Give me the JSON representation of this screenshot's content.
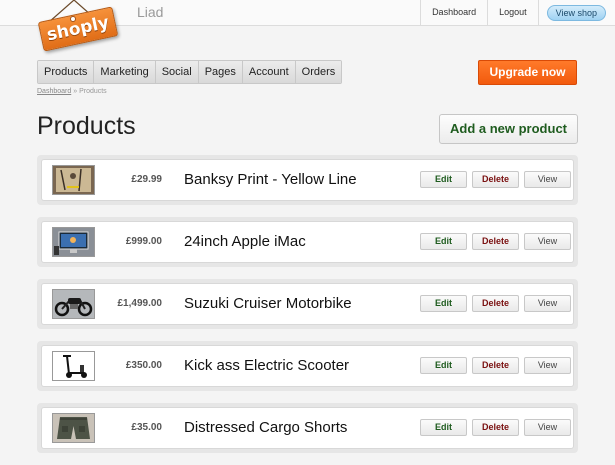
{
  "header": {
    "logo_text": "shoply",
    "username": "Liad",
    "links": [
      {
        "label": "Dashboard"
      },
      {
        "label": "Logout"
      }
    ],
    "view_shop_label": "View shop"
  },
  "nav": {
    "tabs": [
      {
        "label": "Products"
      },
      {
        "label": "Marketing"
      },
      {
        "label": "Social"
      },
      {
        "label": "Pages"
      },
      {
        "label": "Account"
      },
      {
        "label": "Orders"
      }
    ],
    "upgrade_label": "Upgrade now"
  },
  "breadcrumb": {
    "link": "Dashboard",
    "separator": "»",
    "current": "Products"
  },
  "page": {
    "title": "Products",
    "add_button": "Add a new product"
  },
  "products": [
    {
      "price": "£29.99",
      "name": "Banksy Print - Yellow Line",
      "thumb": "print"
    },
    {
      "price": "£999.00",
      "name": "24inch Apple iMac",
      "thumb": "imac"
    },
    {
      "price": "£1,499.00",
      "name": "Suzuki Cruiser Motorbike",
      "thumb": "motorbike"
    },
    {
      "price": "£350.00",
      "name": "Kick ass Electric Scooter",
      "thumb": "scooter"
    },
    {
      "price": "£35.00",
      "name": "Distressed Cargo Shorts",
      "thumb": "shorts"
    }
  ],
  "row_actions": {
    "edit": "Edit",
    "delete": "Delete",
    "view": "View"
  },
  "colors": {
    "accent_orange": "#f25a0d",
    "edit_green": "#1f5c1f",
    "delete_red": "#7a1010",
    "view_shop_blue": "#9fd2f2"
  }
}
